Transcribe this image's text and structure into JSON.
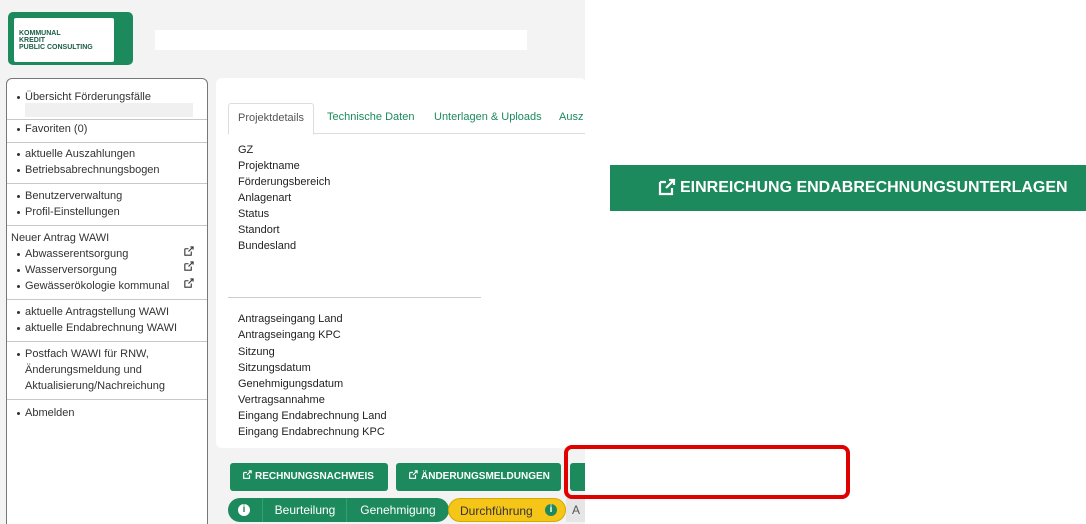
{
  "logo": {
    "line1": "KOMMUNAL",
    "line2": "KREDIT",
    "line3": "PUBLIC CONSULTING"
  },
  "sidebar": {
    "items": [
      {
        "label": "Übersicht Förderungsfälle"
      },
      {
        "label": "Favoriten (0)"
      },
      {
        "label": "aktuelle Auszahlungen"
      },
      {
        "label": "Betriebsabrechnungsbogen"
      },
      {
        "label": "Benutzerverwaltung"
      },
      {
        "label": "Profil-Einstellungen"
      },
      {
        "label": "Neuer Antrag WAWI"
      },
      {
        "label": "Abwasserentsorgung"
      },
      {
        "label": "Wasserversorgung"
      },
      {
        "label": "Gewässerökologie kommunal"
      },
      {
        "label": "aktuelle Antragstellung WAWI"
      },
      {
        "label": "aktuelle Endabrechnung WAWI"
      },
      {
        "label": "Postfach WAWI für RNW,"
      },
      {
        "label": "Änderungsmeldung und"
      },
      {
        "label": "Aktualisierung/Nachreichung"
      },
      {
        "label": "Abmelden"
      }
    ]
  },
  "tabs": [
    {
      "label": "Projektdetails"
    },
    {
      "label": "Technische Daten"
    },
    {
      "label": "Unterlagen & Uploads"
    },
    {
      "label": "Ausz"
    }
  ],
  "fields_top": [
    "GZ",
    "Projektname",
    "Förderungsbereich",
    "Anlagenart",
    "Status",
    "Standort",
    "Bundesland"
  ],
  "fields_bottom": [
    "Antragseingang Land",
    "Antragseingang KPC",
    "Sitzung",
    "Sitzungsdatum",
    "Genehmigungsdatum",
    "Vertragsannahme",
    "Eingang Endabrechnung Land",
    "Eingang Endabrechnung KPC"
  ],
  "buttons": {
    "rechnungsnachweis": "RECHNUNGSNACHWEIS",
    "aenderungsmeldungen": "ÄNDERUNGSMELDUNGEN"
  },
  "status": {
    "info": "i",
    "beurteilung": "Beurteilung",
    "genehmigung": "Genehmigung",
    "durchfuehrung": "Durchführung",
    "cut": "A"
  },
  "callout": {
    "label": "EINREICHUNG ENDABRECHNUNGSUNTERLAGEN"
  },
  "colors": {
    "brand": "#1c8a5c",
    "stage_active": "#f5c518",
    "highlight": "#e00000"
  },
  "icons": {
    "external": "external-link-icon",
    "info": "info-icon"
  }
}
